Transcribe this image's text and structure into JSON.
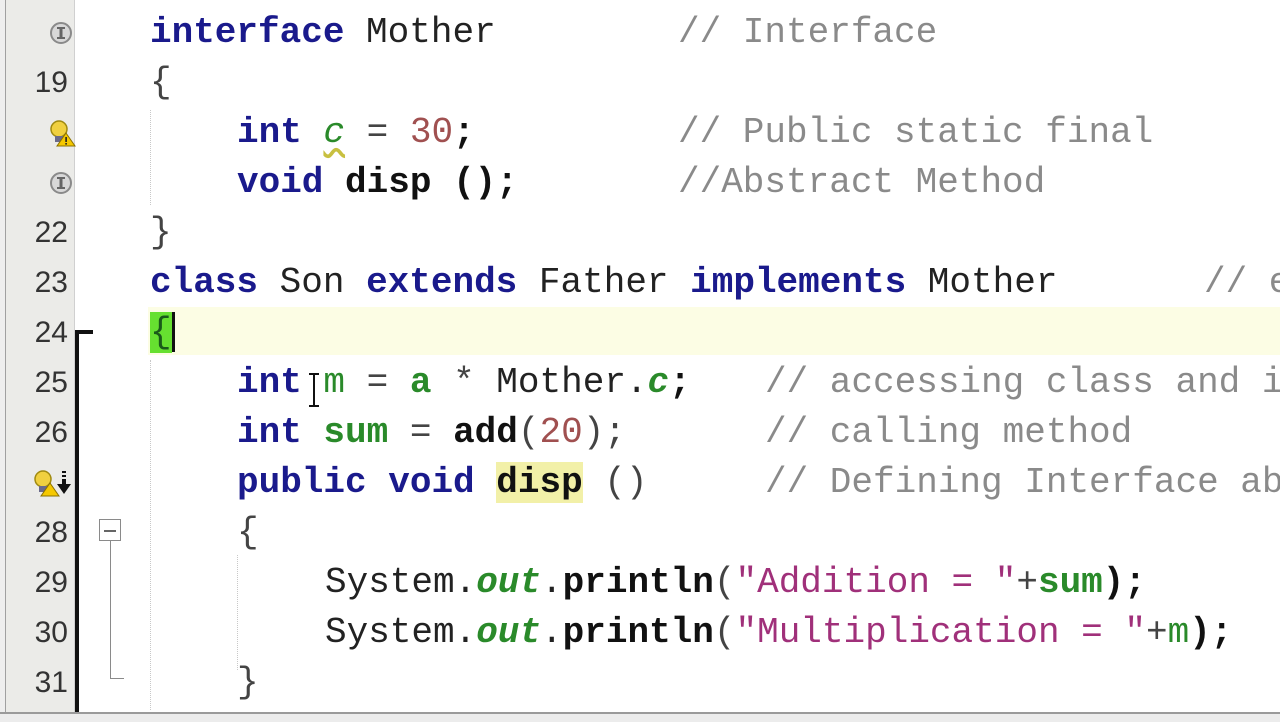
{
  "editor": {
    "language": "Java",
    "current_line": 24,
    "lines": [
      {
        "num": "",
        "icon": "implements-icon"
      },
      {
        "num": "19"
      },
      {
        "num": "",
        "icon": "warning-hint-icon"
      },
      {
        "num": "",
        "icon": "implements-icon"
      },
      {
        "num": "22"
      },
      {
        "num": "23"
      },
      {
        "num": "24"
      },
      {
        "num": "25"
      },
      {
        "num": "26"
      },
      {
        "num": "",
        "icon": "warning-hint-override-icon"
      },
      {
        "num": "28"
      },
      {
        "num": "29"
      },
      {
        "num": "30"
      },
      {
        "num": "31"
      }
    ],
    "code": {
      "l18": {
        "kw": "interface",
        "name": "Mother",
        "comment": "// Interface"
      },
      "l19": {
        "brace": "{"
      },
      "l20": {
        "kw": "int",
        "field": "c",
        "eq": "=",
        "value": "30",
        "semi": ";",
        "comment": "// Public static final"
      },
      "l21": {
        "kw": "void",
        "method": "disp",
        "paren": "();",
        "comment": "//Abstract Method"
      },
      "l22": {
        "brace": "}"
      },
      "l23": {
        "kw1": "class",
        "name": "Son",
        "kw2": "extends",
        "parent": "Father",
        "kw3": "implements",
        "iface": "Mother",
        "comment": "// e"
      },
      "l24": {
        "brace": "{"
      },
      "l25": {
        "kw": "int",
        "var": "m",
        "eq": "=",
        "a": "a",
        "op": "*",
        "cls": "Mother.",
        "field": "c",
        "semi": ";",
        "comment": "// accessing class and i"
      },
      "l26": {
        "kw": "int",
        "var": "sum",
        "eq": "=",
        "call": "add",
        "open": "(",
        "arg": "20",
        "close": ");",
        "comment": "// calling method"
      },
      "l27": {
        "kw1": "public",
        "kw2": "void",
        "method": "disp",
        "paren": "()",
        "comment": "// Defining Interface ab"
      },
      "l28": {
        "brace": "{"
      },
      "l29": {
        "sys": "System.",
        "out": "out",
        "dot": ".",
        "println": "println",
        "open": "(",
        "str": "\"Addition = \"",
        "plus": "+",
        "var": "sum",
        "close": ");"
      },
      "l30": {
        "sys": "System.",
        "out": "out",
        "dot": ".",
        "println": "println",
        "open": "(",
        "str": "\"Multiplication = \"",
        "plus": "+",
        "var": "m",
        "close": ");"
      },
      "l31": {
        "brace": "}"
      }
    },
    "colors": {
      "keyword": "#1a1a8c",
      "comment": "#8a8a8a",
      "string": "#a0307a",
      "number": "#a05050",
      "field": "#2a8a2a",
      "current_line_bg": "#fcfde4",
      "brace_match": "#66e030",
      "occurrence_highlight": "#f2f0a8"
    }
  }
}
